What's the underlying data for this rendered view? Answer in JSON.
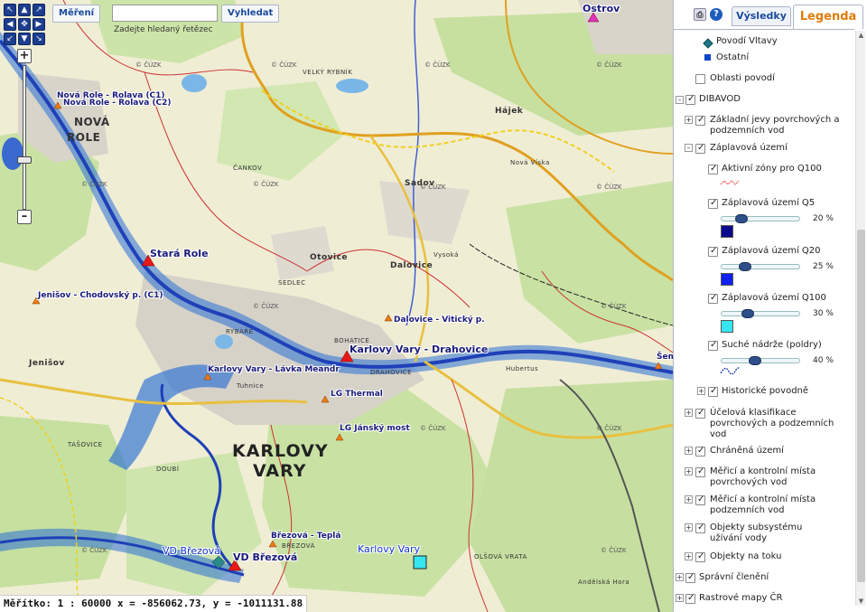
{
  "search": {
    "tab_label": "Měření",
    "input_value": "",
    "button_label": "Vyhledat",
    "hint": "Zadejte hledaný řetězec"
  },
  "status": {
    "text": "Měřítko: 1 : 60000 x = -856062.73, y = -1011131.88"
  },
  "map": {
    "stations": [
      {
        "label": "Nová Role - Rolava (C1)"
      },
      {
        "label": "Nová Role - Rolava (C2)"
      },
      {
        "label": "Stará Role"
      },
      {
        "label": "Jenišov - Chodovský p. (C1)"
      },
      {
        "label": "Dalovice - Vitický p."
      },
      {
        "label": "Karlovy Vary - Drahovice"
      },
      {
        "label": "Karlovy Vary - Lávka Meandr"
      },
      {
        "label": "LG Thermal"
      },
      {
        "label": "LG Jánský most"
      },
      {
        "label": "Březová - Teplá"
      },
      {
        "label": "VD Březová"
      },
      {
        "label": "VD Březová"
      },
      {
        "label": "Karlovy Vary"
      },
      {
        "label": "Ostrov"
      },
      {
        "label": "Šem"
      }
    ],
    "places": [
      {
        "label": "KARLOVY"
      },
      {
        "label": "VARY"
      },
      {
        "label": "NOVÁ"
      },
      {
        "label": "ROLE"
      },
      {
        "label": "Sadov"
      },
      {
        "label": "Otovice"
      },
      {
        "label": "Dalovice"
      },
      {
        "label": "Hájek"
      },
      {
        "label": "Jenišov"
      },
      {
        "label": "RYBÁŘE"
      },
      {
        "label": "DRAHOVICE"
      },
      {
        "label": "BOHATICE"
      },
      {
        "label": "Nová Víska"
      },
      {
        "label": "Hubertus"
      },
      {
        "label": "OLŠOVÁ VRATA"
      },
      {
        "label": "Andělská Hora"
      },
      {
        "label": "BŘEZOVÁ"
      },
      {
        "label": "TAŠOVICE"
      },
      {
        "label": "DOUBÍ"
      },
      {
        "label": "SEDLEC"
      },
      {
        "label": "VELKÝ RYBNÍK"
      },
      {
        "label": "Vysoká"
      },
      {
        "label": "ČANKOV"
      },
      {
        "label": "Tuhnice"
      }
    ],
    "cuzk_label": "© ČÚZK",
    "cuzk_count": 14
  },
  "panel": {
    "results_tab": "Výsledky",
    "legend_tab": "Legenda",
    "print_icon": "printer-icon",
    "help_icon": "help-icon",
    "tree": {
      "povodi_vltavy": "Povodí Vltavy",
      "ostatni": "Ostatní",
      "oblasti_povodi": "Oblasti povodí",
      "dibavod": "DIBAVOD",
      "zakladni_jevy": "Základní jevy povrchových a podzemních vod",
      "zaplavova_uzemi": "Záplavová území",
      "aktivni_zony": "Aktivní zóny pro Q100",
      "zu_q5": "Záplavová území Q5",
      "zu_q5_pct": "20 %",
      "zu_q20": "Záplavová území Q20",
      "zu_q20_pct": "25 %",
      "zu_q100": "Záplavová území Q100",
      "zu_q100_pct": "30 %",
      "suche_nadrze": "Suché nádrže (poldry)",
      "suche_nadrze_pct": "40 %",
      "historicke_povodne": "Historické povodně",
      "ucelova_klasifikace": "Účelová klasifikace povrchových a podzemních vod",
      "chranena_uzemi": "Chráněná území",
      "merici_povrch": "Měřicí a kontrolní místa povrchových vod",
      "merici_podzem": "Měřicí a kontrolní místa podzemních vod",
      "objekty_subsystemu": "Objekty subsystému užívání vody",
      "objekty_na_toku": "Objekty na toku",
      "spravni_cleneni": "Správní členění",
      "rastrove_mapy": "Rastrové mapy ČR"
    },
    "opacity": {
      "q5": 0.2,
      "q20": 0.25,
      "q100": 0.3,
      "poldry": 0.4
    },
    "colors": {
      "q5": "#0a0a8c",
      "q20": "#1020f0",
      "q100": "#35e6f0",
      "povodi_vltavy": "#1e7a8a",
      "ostatni": "#1046c8",
      "accent": "#e07b0a",
      "river": "#1e40b8",
      "flood": "#2a6fd6"
    }
  }
}
